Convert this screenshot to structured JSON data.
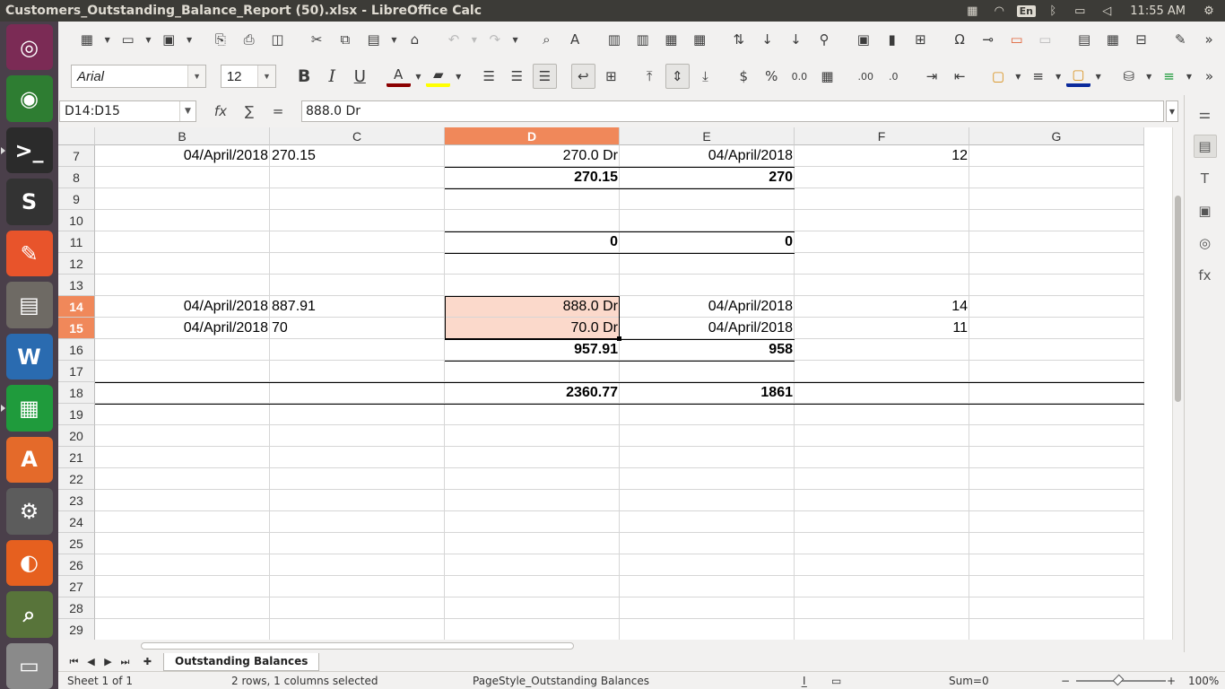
{
  "window": {
    "title": "Customers_Outstanding_Balance_Report (50).xlsx - LibreOffice Calc",
    "clock": "11:55 AM",
    "lang": "En"
  },
  "launcher": {
    "items": [
      {
        "name": "ubuntu-dash-icon",
        "glyph": "◎",
        "bg": "#7b2b55"
      },
      {
        "name": "chrome-icon",
        "glyph": "◉",
        "bg": "#2e7d32"
      },
      {
        "name": "terminal-icon",
        "glyph": ">_",
        "bg": "#2b2b2b"
      },
      {
        "name": "sublime-text-icon",
        "glyph": "S",
        "bg": "#333333"
      },
      {
        "name": "pen-tool-icon",
        "glyph": "✎",
        "bg": "#e8542b"
      },
      {
        "name": "file-manager-icon",
        "glyph": "▤",
        "bg": "#6e6a64"
      },
      {
        "name": "writer-icon",
        "glyph": "W",
        "bg": "#2a6bb0"
      },
      {
        "name": "calc-icon",
        "glyph": "▦",
        "bg": "#1f9b3c"
      },
      {
        "name": "software-center-icon",
        "glyph": "A",
        "bg": "#e46a2a"
      },
      {
        "name": "system-settings-icon",
        "glyph": "⚙",
        "bg": "#5c5c5c"
      },
      {
        "name": "firefox-icon",
        "glyph": "◐",
        "bg": "#e6601f"
      },
      {
        "name": "image-viewer-icon",
        "glyph": "⌕",
        "bg": "#58743a"
      },
      {
        "name": "disk-icon",
        "glyph": "▭",
        "bg": "#8a8a8a"
      }
    ]
  },
  "formatting": {
    "font_name": "Arial",
    "font_size": "12"
  },
  "formula_bar": {
    "name_box": "D14:D15",
    "fx_label": "fx",
    "sum_label": "∑",
    "equals_label": "=",
    "content": "888.0 Dr"
  },
  "columns": [
    "B",
    "C",
    "D",
    "E",
    "F",
    "G"
  ],
  "selected_column": "D",
  "rows": [
    {
      "num": "7",
      "B": "04/April/2018",
      "C": "270.15",
      "D": "270.0 Dr",
      "E": "04/April/2018",
      "F": "12",
      "G": ""
    },
    {
      "num": "8",
      "B": "",
      "C": "",
      "D": "270.15",
      "E": "270",
      "F": "",
      "G": ""
    },
    {
      "num": "9",
      "B": "",
      "C": "",
      "D": "",
      "E": "",
      "F": "",
      "G": ""
    },
    {
      "num": "10",
      "B": "",
      "C": "",
      "D": "",
      "E": "",
      "F": "",
      "G": ""
    },
    {
      "num": "11",
      "B": "",
      "C": "",
      "D": "0",
      "E": "0",
      "F": "",
      "G": ""
    },
    {
      "num": "12",
      "B": "",
      "C": "",
      "D": "",
      "E": "",
      "F": "",
      "G": ""
    },
    {
      "num": "13",
      "B": "",
      "C": "",
      "D": "",
      "E": "",
      "F": "",
      "G": ""
    },
    {
      "num": "14",
      "B": "04/April/2018",
      "C": "887.91",
      "D": "888.0 Dr",
      "E": "04/April/2018",
      "F": "14",
      "G": ""
    },
    {
      "num": "15",
      "B": "04/April/2018",
      "C": "70",
      "D": "70.0 Dr",
      "E": "04/April/2018",
      "F": "11",
      "G": ""
    },
    {
      "num": "16",
      "B": "",
      "C": "",
      "D": "957.91",
      "E": "958",
      "F": "",
      "G": ""
    },
    {
      "num": "17",
      "B": "",
      "C": "",
      "D": "",
      "E": "",
      "F": "",
      "G": ""
    },
    {
      "num": "18",
      "B": "",
      "C": "",
      "D": "2360.77",
      "E": "1861",
      "F": "",
      "G": ""
    },
    {
      "num": "19",
      "B": "",
      "C": "",
      "D": "",
      "E": "",
      "F": "",
      "G": ""
    },
    {
      "num": "20",
      "B": "",
      "C": "",
      "D": "",
      "E": "",
      "F": "",
      "G": ""
    },
    {
      "num": "21",
      "B": "",
      "C": "",
      "D": "",
      "E": "",
      "F": "",
      "G": ""
    },
    {
      "num": "22",
      "B": "",
      "C": "",
      "D": "",
      "E": "",
      "F": "",
      "G": ""
    },
    {
      "num": "23",
      "B": "",
      "C": "",
      "D": "",
      "E": "",
      "F": "",
      "G": ""
    },
    {
      "num": "24",
      "B": "",
      "C": "",
      "D": "",
      "E": "",
      "F": "",
      "G": ""
    },
    {
      "num": "25",
      "B": "",
      "C": "",
      "D": "",
      "E": "",
      "F": "",
      "G": ""
    },
    {
      "num": "26",
      "B": "",
      "C": "",
      "D": "",
      "E": "",
      "F": "",
      "G": ""
    },
    {
      "num": "27",
      "B": "",
      "C": "",
      "D": "",
      "E": "",
      "F": "",
      "G": ""
    },
    {
      "num": "28",
      "B": "",
      "C": "",
      "D": "",
      "E": "",
      "F": "",
      "G": ""
    },
    {
      "num": "29",
      "B": "",
      "C": "",
      "D": "",
      "E": "",
      "F": "",
      "G": ""
    }
  ],
  "selected_rows": [
    "14",
    "15"
  ],
  "bold_rows": [
    "8",
    "11",
    "16",
    "18"
  ],
  "sheet_tab": "Outstanding Balances",
  "status": {
    "sheet": "Sheet 1 of 1",
    "selection": "2 rows, 1 columns selected",
    "page_style": "PageStyle_Outstanding Balances",
    "sum": "Sum=0",
    "zoom": "100%"
  },
  "colors": {
    "selection_header": "#f0885a",
    "selection_fill": "#fbd9cb",
    "topbar": "#3c3b37",
    "launcher": "#4a3f4a"
  }
}
